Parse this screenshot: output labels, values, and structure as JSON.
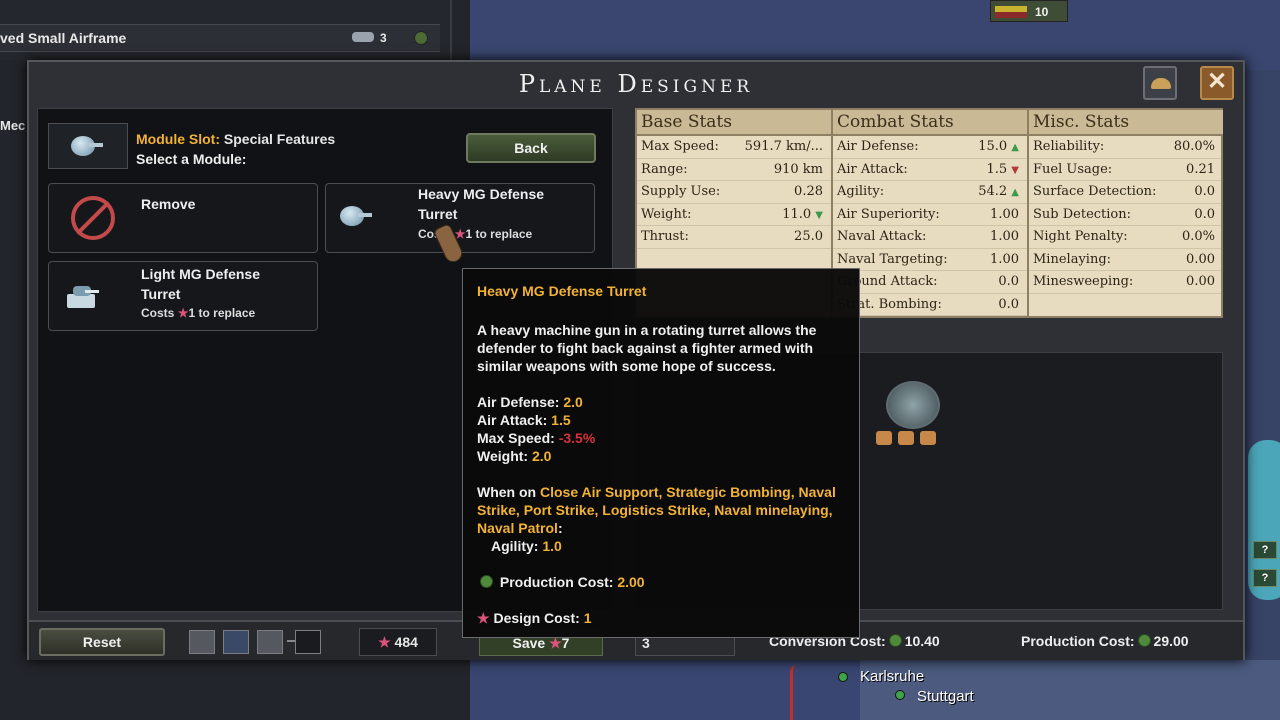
{
  "background": {
    "top_left_airframe": "ved Small Airframe",
    "top_left_count": "3",
    "side_label": "Mec",
    "map_unit_count": "10",
    "cities": [
      "Karlsruhe",
      "Stuttgart"
    ],
    "question_marks": [
      "?",
      "?"
    ]
  },
  "window": {
    "title": "Plane Designer",
    "close_glyph": "✕"
  },
  "left_pane": {
    "slot_prefix": "Module Slot:",
    "slot_name": "Special Features",
    "select_label": "Select a Module:",
    "back_label": "Back",
    "modules": [
      {
        "title": "Remove",
        "cost": ""
      },
      {
        "title_line1": "Heavy MG Defense",
        "title_line2": "Turret",
        "cost_prefix": "Costs",
        "cost_value": "1",
        "cost_suffix": "to replace"
      },
      {
        "title_line1": "Light MG Defense",
        "title_line2": "Turret",
        "cost_prefix": "Costs",
        "cost_value": "1",
        "cost_suffix": "to replace"
      }
    ]
  },
  "stats": {
    "base": {
      "header": "Base Stats",
      "rows": [
        {
          "k": "Max Speed:",
          "v": "591.7 km/..."
        },
        {
          "k": "Range:",
          "v": "910 km"
        },
        {
          "k": "Supply Use:",
          "v": "0.28"
        },
        {
          "k": "Weight:",
          "v": "11.0"
        },
        {
          "k": "Thrust:",
          "v": "25.0"
        }
      ]
    },
    "combat": {
      "header": "Combat Stats",
      "rows": [
        {
          "k": "Air Defense:",
          "v": "15.0"
        },
        {
          "k": "Air Attack:",
          "v": "1.5"
        },
        {
          "k": "Agility:",
          "v": "54.2"
        },
        {
          "k": "Air Superiority:",
          "v": "1.00"
        },
        {
          "k": "Naval Attack:",
          "v": "1.00"
        },
        {
          "k": "Naval Targeting:",
          "v": "1.00"
        },
        {
          "k": "Ground Attack:",
          "v": "0.0"
        },
        {
          "k": "Strat. Bombing:",
          "v": "0.0"
        }
      ]
    },
    "misc": {
      "header": "Misc. Stats",
      "rows": [
        {
          "k": "Reliability:",
          "v": "80.0%"
        },
        {
          "k": "Fuel Usage:",
          "v": "0.21"
        },
        {
          "k": "Surface Detection:",
          "v": "0.0"
        },
        {
          "k": "Sub Detection:",
          "v": "0.0"
        },
        {
          "k": "Night Penalty:",
          "v": "0.0%"
        },
        {
          "k": "Minelaying:",
          "v": "0.00"
        },
        {
          "k": "Minesweeping:",
          "v": "0.00"
        }
      ]
    }
  },
  "bottom_bar": {
    "reset_label": "Reset",
    "design_cost": "484",
    "save_label": "Save",
    "save_cost": "7",
    "count": "3",
    "conversion_label": "Conversion Cost:",
    "conversion_value": "10.40",
    "production_label": "Production Cost:",
    "production_value": "29.00"
  },
  "tooltip": {
    "title": "Heavy MG Defense Turret",
    "description": "A heavy machine gun in a rotating turret allows the defender to fight back against a fighter armed with similar weapons with some hope of success.",
    "stats": [
      {
        "k": "Air Defense:",
        "v": "2.0"
      },
      {
        "k": "Air Attack:",
        "v": "1.5"
      },
      {
        "k": "Max Speed:",
        "v": "-3.5%"
      },
      {
        "k": "Weight:",
        "v": "2.0"
      }
    ],
    "when_on_prefix": "When on",
    "when_on_missions": "Close Air Support, Strategic Bombing, Naval Strike, Port Strike, Logistics Strike, Naval minelaying, Naval Patrol",
    "when_on_suffix": ":",
    "agility_label": "Agility:",
    "agility_value": "1.0",
    "production_label": "Production Cost:",
    "production_value": "2.00",
    "design_label": "Design Cost:",
    "design_value": "1"
  },
  "colors": {
    "accent_gold": "#f2b234",
    "negative_red": "#d9303a",
    "parchment": "#e8dcc0"
  }
}
